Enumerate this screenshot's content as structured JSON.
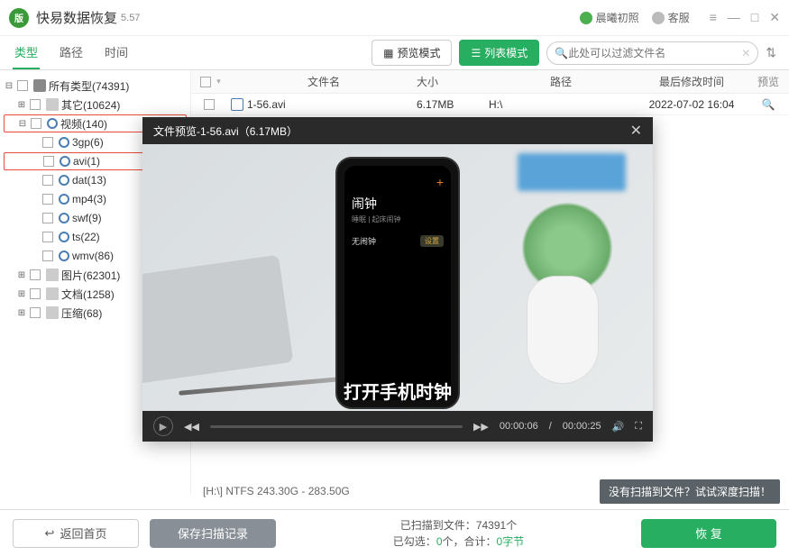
{
  "app": {
    "title": "快易数据恢复",
    "version": "5.57"
  },
  "user": {
    "name": "晨曦初照",
    "support": "客服"
  },
  "tabs": {
    "type": "类型",
    "path": "路径",
    "time": "时间"
  },
  "modes": {
    "preview": "预览模式",
    "list": "列表模式"
  },
  "search": {
    "placeholder": "此处可以过滤文件名"
  },
  "tree": {
    "root": "所有类型(74391)",
    "other": "其它(10624)",
    "video": "视频(140)",
    "v_3gp": "3gp(6)",
    "v_avi": "avi(1)",
    "v_dat": "dat(13)",
    "v_mp4": "mp4(3)",
    "v_swf": "swf(9)",
    "v_ts": "ts(22)",
    "v_wmv": "wmv(86)",
    "image": "图片(62301)",
    "doc": "文档(1258)",
    "zip": "压缩(68)"
  },
  "cols": {
    "name": "文件名",
    "size": "大小",
    "path": "路径",
    "date": "最后修改时间",
    "prev": "预览"
  },
  "file": {
    "name": "1-56.avi",
    "size": "6.17MB",
    "path": "H:\\",
    "date": "2022-07-02  16:04"
  },
  "preview": {
    "title": "文件预览-1-56.avi（6.17MB）",
    "phone_title": "闹钟",
    "phone_sub": "睡眠 | 起床闹钟",
    "phone_row_l": "无闹钟",
    "phone_row_r": "设置",
    "caption": "打开手机时钟",
    "time_cur": "00:00:06",
    "time_tot": "00:00:25"
  },
  "disk": "[H:\\] NTFS 243.30G - 283.50G",
  "deep": "没有扫描到文件？试试深度扫描！",
  "footer": {
    "home": "返回首页",
    "save": "保存扫描记录",
    "scanned_l": "已扫描到文件：",
    "scanned_c": "74391",
    "scanned_s": "个",
    "sel_l": "已勾选：",
    "sel_c": "0",
    "sel_m": "个，合计：",
    "sel_b": "0字节",
    "recover": "恢 复"
  }
}
